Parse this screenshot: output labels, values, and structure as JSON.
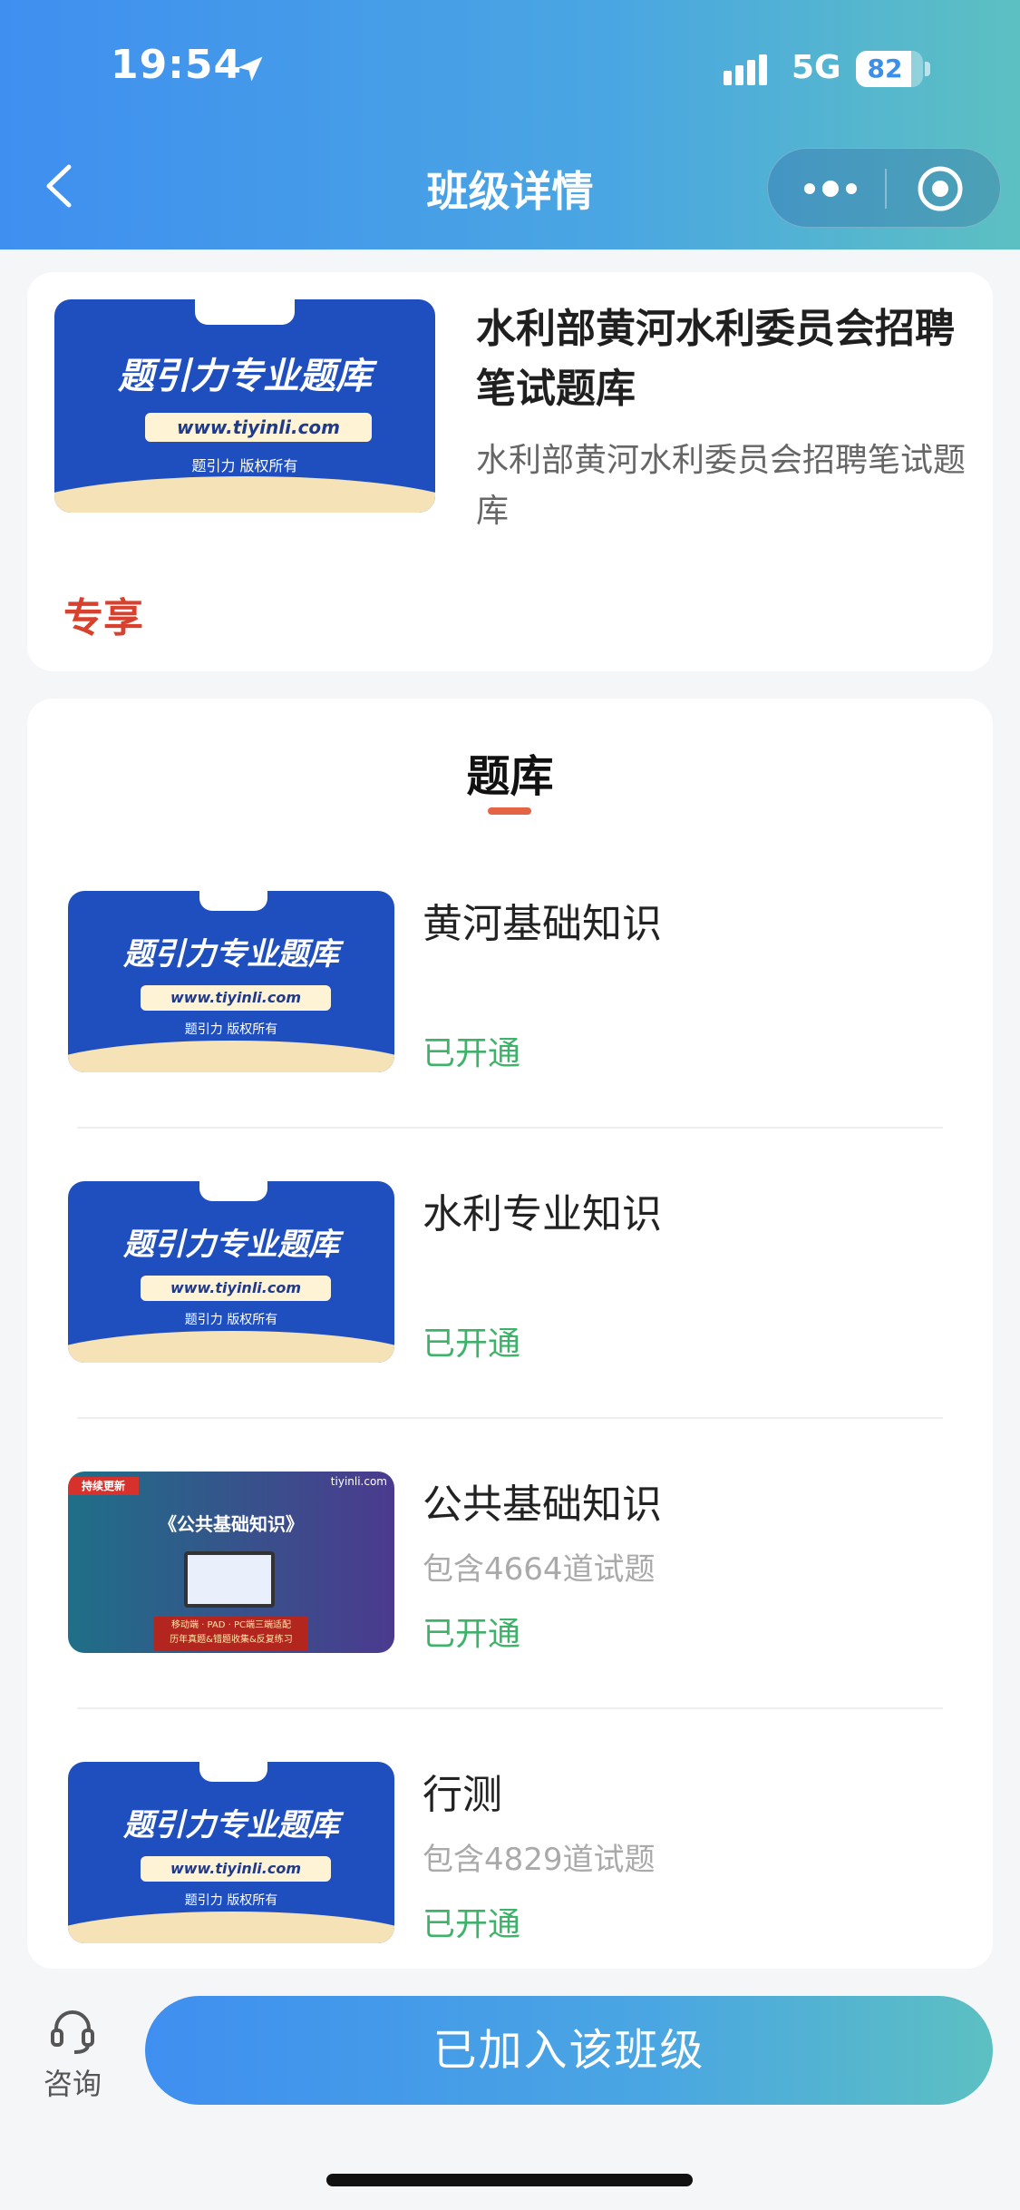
{
  "status_bar": {
    "time": "19:54",
    "network": "5G",
    "battery": "82",
    "battery_level": 0.82
  },
  "nav": {
    "title": "班级详情"
  },
  "class_info": {
    "title": "水利部黄河水利委员会招聘笔试题库",
    "description": "水利部黄河水利委员会招聘笔试题库",
    "exclusive_label": "专享"
  },
  "thumbnail_default": {
    "brand_tag": "题引力",
    "title": "题引力专业题库",
    "url": "www.tiyinli.com",
    "copyright": "题引力 版权所有"
  },
  "thumbnail_public": {
    "badge": "持续更新",
    "url": "tiyinli.com",
    "title": "《公共基础知识》",
    "line1": "移动端 · PAD · PC端三端适配",
    "line2": "历年真题&错题收集&反复练习"
  },
  "bank": {
    "section_title": "题库",
    "items": [
      {
        "title": "黄河基础知识",
        "subtitle": "",
        "status": "已开通",
        "thumb": "default"
      },
      {
        "title": "水利专业知识",
        "subtitle": "",
        "status": "已开通",
        "thumb": "default"
      },
      {
        "title": "公共基础知识",
        "subtitle": "包含4664道试题",
        "status": "已开通",
        "thumb": "public"
      },
      {
        "title": "行测",
        "subtitle": "包含4829道试题",
        "status": "已开通",
        "thumb": "default"
      }
    ]
  },
  "bottom": {
    "consult_label": "咨询",
    "join_label": "已加入该班级"
  },
  "colors": {
    "header_gradient_start": "#3f8ff0",
    "header_gradient_end": "#5cc0c2",
    "exclusive": "#d8412e",
    "status_green": "#3fb26a",
    "underline": "#e46546"
  },
  "icons": {
    "back": "chevron-left-icon",
    "location": "location-arrow-icon",
    "signal": "signal-icon",
    "more": "more-dots-icon",
    "close": "target-close-icon",
    "consult": "headset-icon"
  }
}
